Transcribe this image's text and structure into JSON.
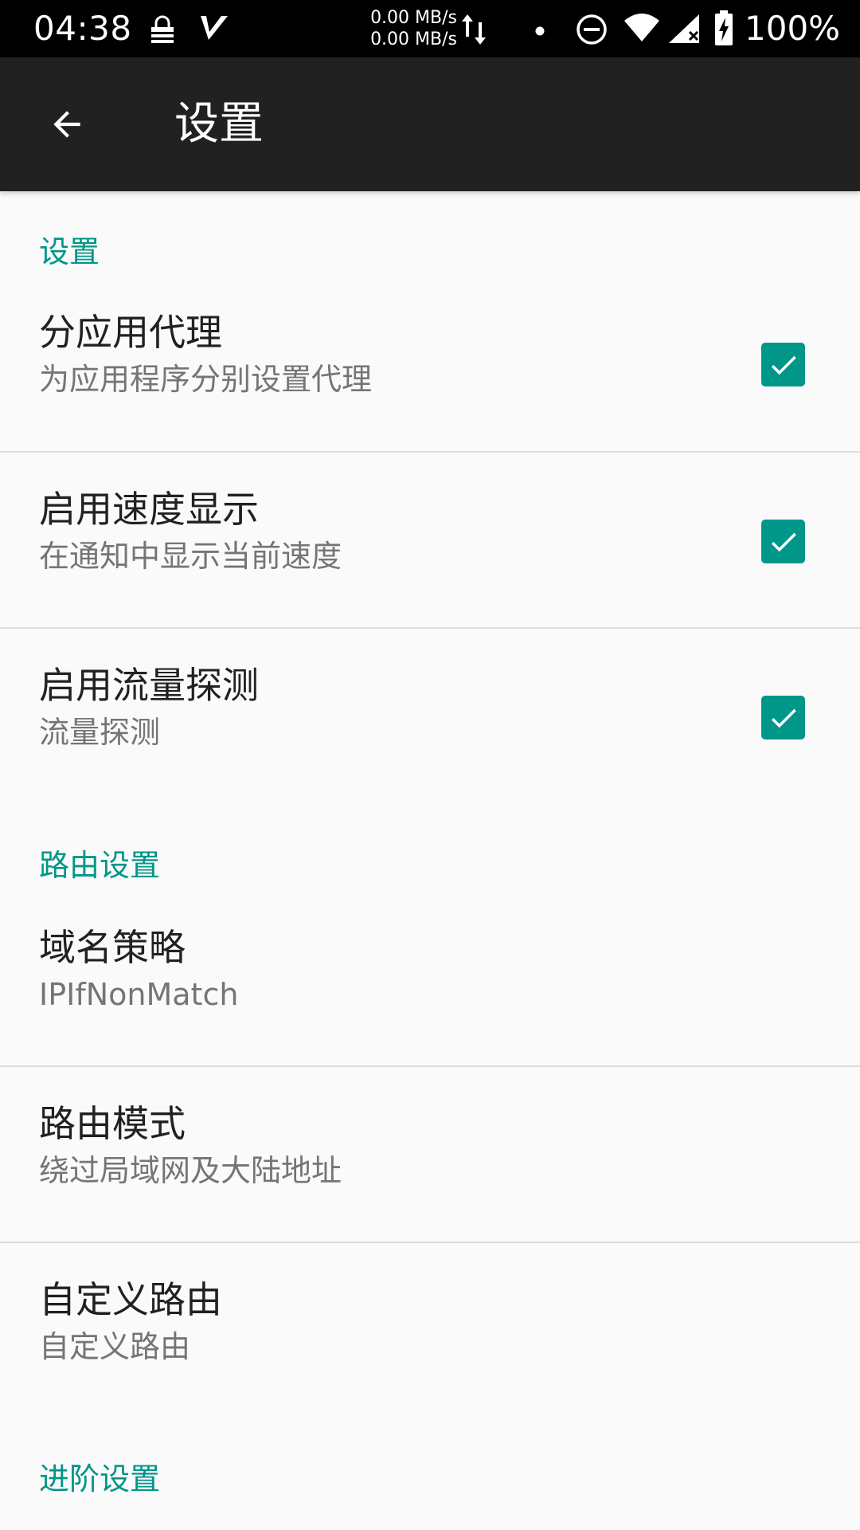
{
  "status_bar": {
    "time": "04:38",
    "net_up": "0.00 MB/s",
    "net_down": "0.00 MB/s",
    "battery": "100%",
    "icons": [
      "vpn-lock-icon",
      "v-app-icon",
      "data-arrows-icon",
      "dot-icon",
      "dnd-icon",
      "wifi-icon",
      "signal-icon",
      "battery-charging-icon"
    ]
  },
  "app_bar": {
    "title": "设置",
    "back_icon": "arrow-left-icon"
  },
  "sections": [
    {
      "header": "设置",
      "items": [
        {
          "title": "分应用代理",
          "summary": "为应用程序分别设置代理",
          "checked": true
        },
        {
          "title": "启用速度显示",
          "summary": "在通知中显示当前速度",
          "checked": true
        },
        {
          "title": "启用流量探测",
          "summary": "流量探测",
          "checked": true
        }
      ]
    },
    {
      "header": "路由设置",
      "items": [
        {
          "title": "域名策略",
          "summary": "IPIfNonMatch"
        },
        {
          "title": "路由模式",
          "summary": "绕过局域网及大陆地址"
        },
        {
          "title": "自定义路由",
          "summary": "自定义路由"
        }
      ]
    },
    {
      "header": "进阶设置",
      "items": []
    }
  ],
  "colors": {
    "accent": "#009688",
    "app_bar": "#212121",
    "status_bar": "#000000",
    "background": "#fafafa"
  }
}
